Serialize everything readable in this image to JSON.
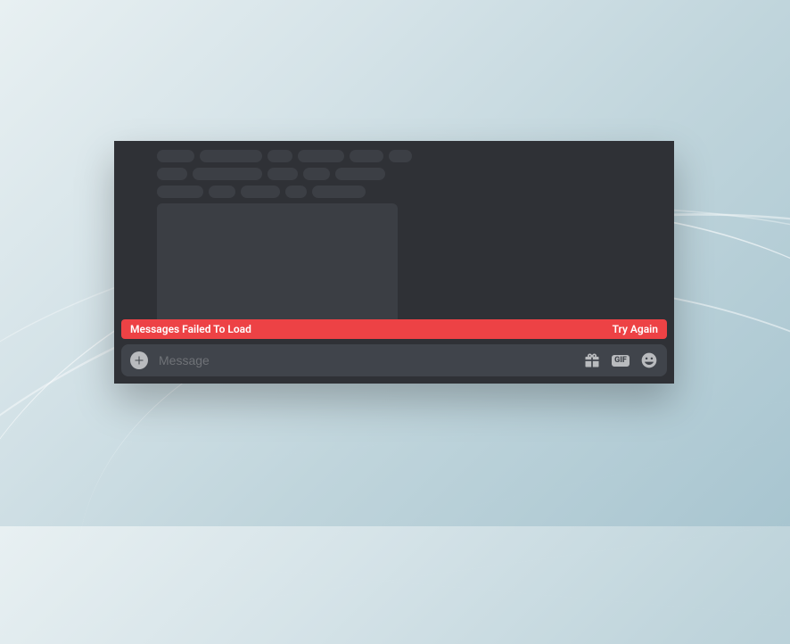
{
  "colors": {
    "error_bg": "#ed4245",
    "composer_bg": "#40444b",
    "window_bg": "#2f3136",
    "icon_fill": "#b9bbbe"
  },
  "error_banner": {
    "message": "Messages Failed To Load",
    "action_label": "Try Again"
  },
  "composer": {
    "placeholder": "Message",
    "value": "",
    "gif_label": "GIF"
  }
}
